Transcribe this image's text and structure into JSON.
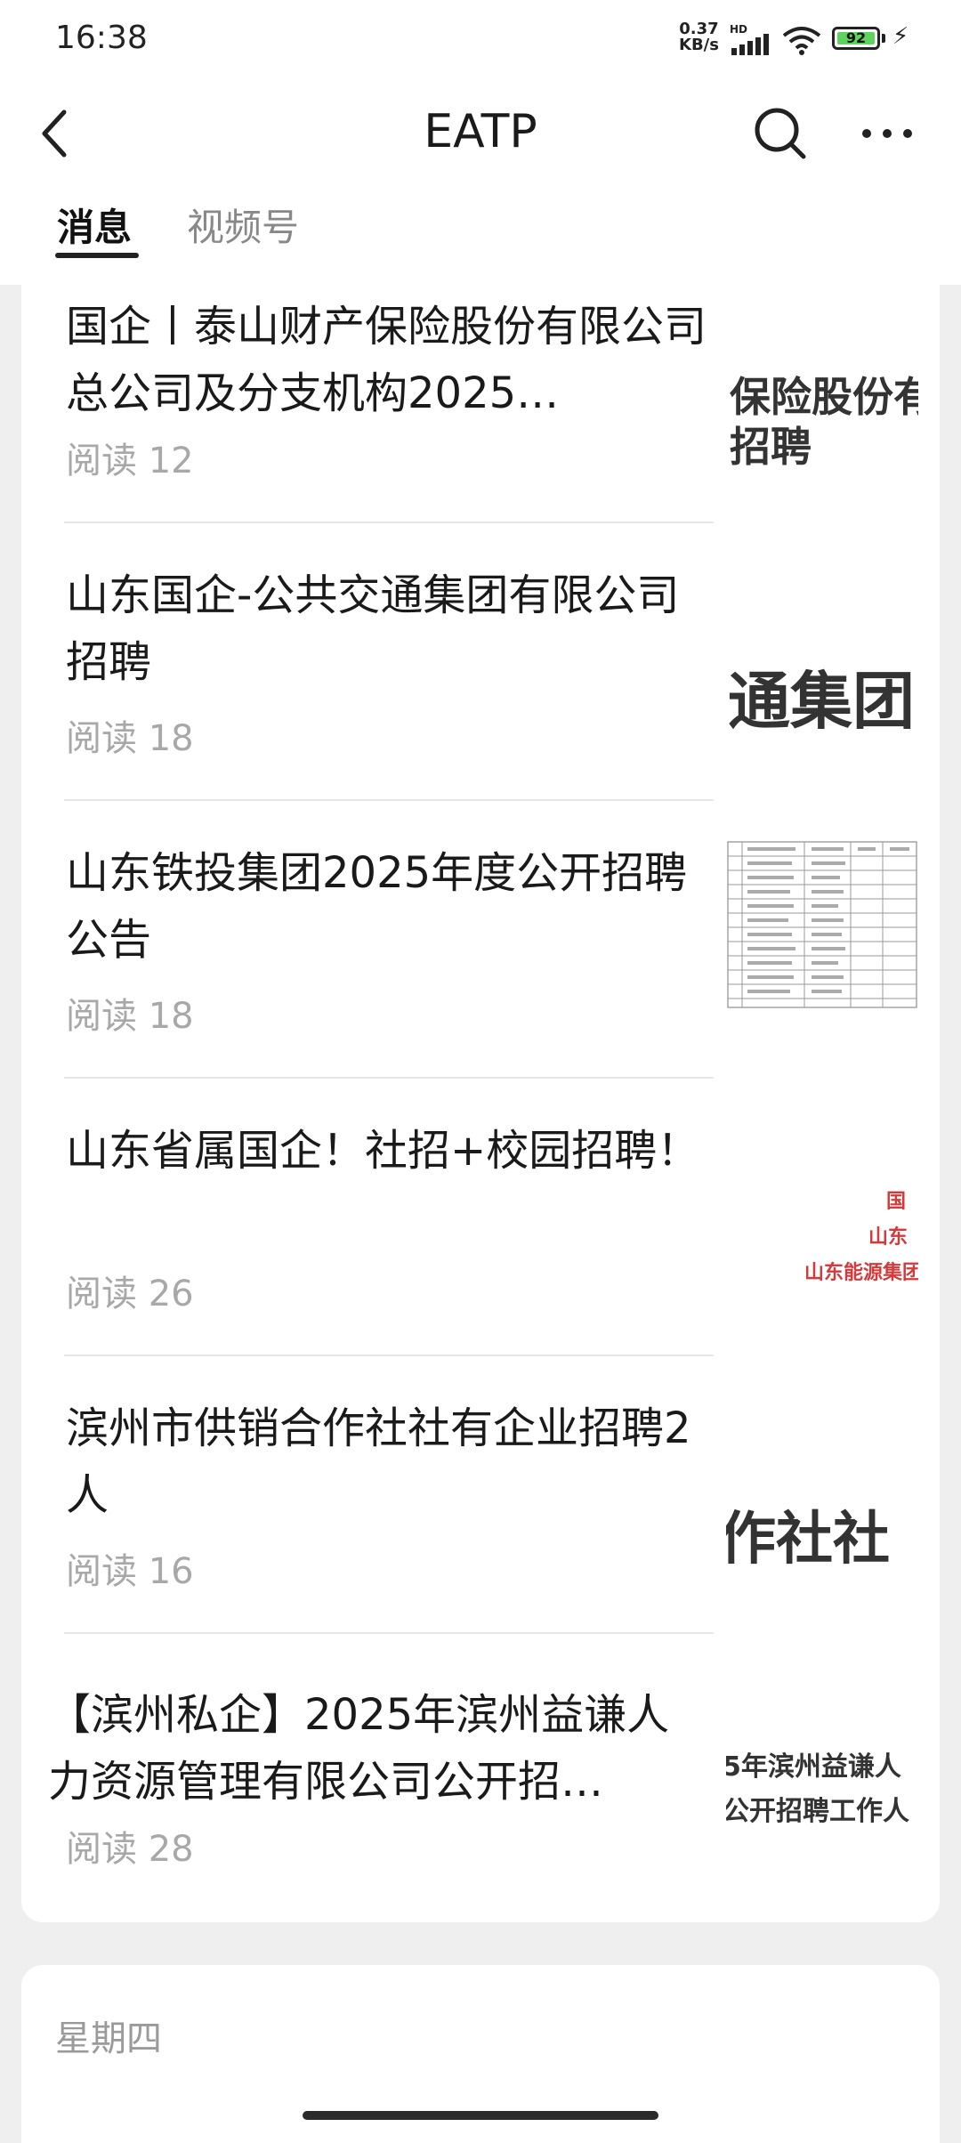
{
  "status_bar": {
    "time": "16:38",
    "network_speed_value": "0.37",
    "network_speed_unit": "KB/s",
    "hd_label": "HD",
    "battery_level": "92"
  },
  "nav": {
    "title": "EATP",
    "back_icon": "chevron-left-icon",
    "search_icon": "search-icon",
    "more_icon": "more-horizontal-icon"
  },
  "tabs": [
    {
      "label": "消息",
      "active": true
    },
    {
      "label": "视频号",
      "active": false
    }
  ],
  "articles": [
    {
      "title": "国企丨泰山财产保险股份有限公司总公司及分支机构2025…",
      "reads": "阅读 12",
      "thumb_lines": [
        "保险股份有",
        "招聘"
      ]
    },
    {
      "title": "山东国企-公共交通集团有限公司招聘",
      "reads": "阅读 18",
      "thumb_lines": [
        "通集团"
      ]
    },
    {
      "title": "山东铁投集团2025年度公开招聘公告",
      "reads": "阅读 18",
      "thumb_lines": []
    },
    {
      "title": "山东省属国企！社招+校园招聘！",
      "reads": "阅读 26",
      "thumb_lines": [
        "国",
        "山东",
        "山东能源集团"
      ]
    },
    {
      "title": "滨州市供销合作社社有企业招聘2人",
      "reads": "阅读 16",
      "thumb_lines": [
        "作社社"
      ]
    },
    {
      "title": "【滨州私企】2025年滨州益谦人力资源管理有限公司公开招…",
      "reads": "阅读 28",
      "thumb_lines": [
        "5年滨州益谦人",
        "公开招聘工作人"
      ]
    }
  ],
  "next_section": {
    "day_label": "星期四"
  },
  "colors": {
    "accent_battery": "#5ed35e",
    "thumb_red": "#d23b3b",
    "read_gray": "#a8a8a8"
  }
}
